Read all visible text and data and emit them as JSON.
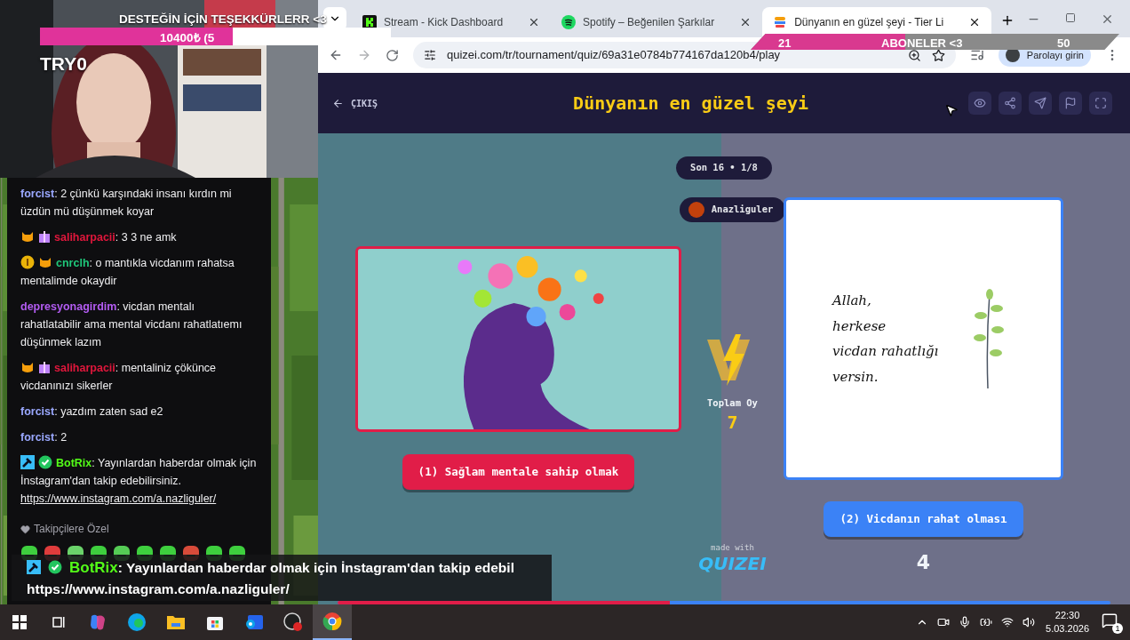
{
  "stream_overlay": {
    "goal_title": "DESTEĞİN İÇİN TEŞEKKÜRLERR <3",
    "goal_amount": "10400₺ (5",
    "goal_bar": {
      "level": 0.55
    },
    "streamer_tag": "TRY0"
  },
  "sub_goal": {
    "current": "21",
    "title": "ABONELER <3",
    "target": "50",
    "level": 0.42
  },
  "chat": {
    "messages": [
      {
        "kind": "plain",
        "user": "forcist",
        "color": "#9aa8ff",
        "text": ": 2 çünkü karşındaki insanı kırdın mi üzdün mü düşünmek koyar"
      },
      {
        "kind": "gifter",
        "user": "saliharpacii",
        "color": "#e0173c",
        "text": ": 3 3 ne amk"
      },
      {
        "kind": "founder",
        "user": "cnrclh",
        "color": "#1fc77a",
        "text": ": o mantıkla vicdanım rahatsa mentalimde okaydir"
      },
      {
        "kind": "plain",
        "user": "depresyonagirdim",
        "color": "#b35cf2",
        "text": ": vicdan mentalı rahatlatabilir ama mental vicdanı rahatlatıemı düşünmek lazım"
      },
      {
        "kind": "gifter",
        "user": "saliharpacii",
        "color": "#e0173c",
        "text": ": mentaliniz çökünce vicdanınızı sikerler"
      },
      {
        "kind": "plain",
        "user": "forcist",
        "color": "#9aa8ff",
        "text": ": yazdım zaten sad e2"
      },
      {
        "kind": "plain",
        "user": "forcist",
        "color": "#9aa8ff",
        "text": ": 2"
      },
      {
        "kind": "bot",
        "user": "BotRix",
        "color": "#53fc18",
        "text": ": Yayınlardan haberdar olmak için İnstagram'dan takip edebilirsiniz.",
        "link": "https://www.instagram.com/a.nazliguler/"
      }
    ],
    "emote_section": "Takipçilere Özel"
  },
  "alert": {
    "user": "BotRix",
    "text": ": Yayınlardan haberdar olmak için İnstagram'dan takip edebil",
    "link": "https://www.instagram.com/a.nazliguler/"
  },
  "browser": {
    "tabs": [
      {
        "kind": "kick",
        "title": "Stream - Kick Dashboard",
        "selected": false
      },
      {
        "kind": "spotify",
        "title": "Spotify – Beğenilen Şarkılar",
        "selected": false
      },
      {
        "kind": "quizei",
        "title": "Dünyanın en güzel şeyi - Tier Li",
        "selected": true
      }
    ],
    "url": "quizei.com/tr/tournament/quiz/69a31e0784b774167da120b4/play",
    "profile_button": "Parolayı girin"
  },
  "quiz": {
    "exit": "ÇIKIŞ",
    "title": "Dünyanın en güzel şeyi",
    "round": "Son 16 • 1/8",
    "creator": "Anazliguler",
    "options": [
      {
        "label": "(1) Sağlam mentale sahip olmak",
        "color": "#e11d48"
      },
      {
        "label": "(2) Vicdanın rahat olması",
        "color": "#3b82f6",
        "kind": "note",
        "note_lines": [
          "Allah,",
          "herkese",
          "vicdan rahatlığı",
          "versin."
        ],
        "votes": "4"
      }
    ],
    "total_label": "Toplam Oy",
    "total": "7",
    "made_with": "made with",
    "brand": "QUIZEI",
    "vote_bar": {
      "level": 0.43
    }
  },
  "taskbar": {
    "time": "22:30",
    "date": "5.03.2026",
    "notifications": "1"
  }
}
